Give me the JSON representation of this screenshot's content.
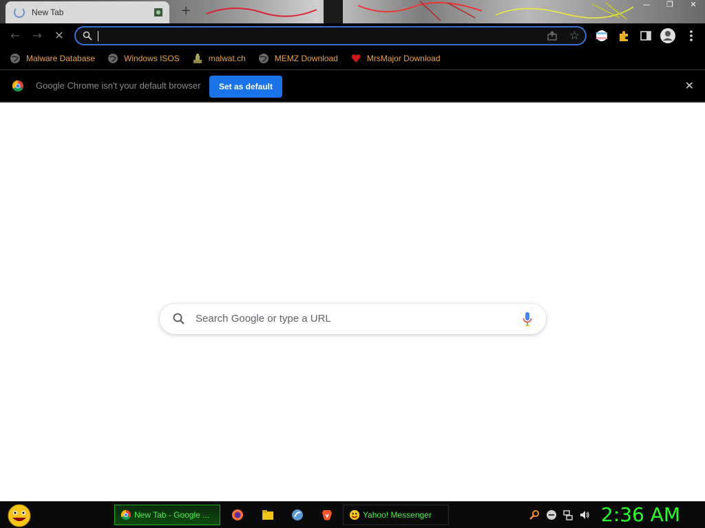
{
  "window": {
    "minimize_glyph": "—",
    "restore_glyph": "❐",
    "close_glyph": "✕"
  },
  "tab": {
    "title": "New Tab",
    "new_tab_glyph": "+"
  },
  "nav": {
    "back_glyph": "←",
    "forward_glyph": "→",
    "stop_glyph": "✕"
  },
  "omnibox": {
    "value": "",
    "star_glyph": "☆"
  },
  "bookmarks": [
    {
      "label": "Malware Database",
      "icon": "globe-icon"
    },
    {
      "label": "Windows ISOS",
      "icon": "globe-icon"
    },
    {
      "label": "malwat.ch",
      "icon": "malwatch-icon"
    },
    {
      "label": "MEMZ Download",
      "icon": "globe-icon"
    },
    {
      "label": "MrsMajor Download",
      "icon": "heart-icon"
    }
  ],
  "infobar": {
    "text": "Google Chrome isn't your default browser",
    "button": "Set as default",
    "close_glyph": "✕"
  },
  "ntp": {
    "search_placeholder": "Search Google or type a URL"
  },
  "taskbar": {
    "items": [
      {
        "label": "New Tab - Google ...",
        "icon": "chrome-icon",
        "active": true
      },
      {
        "label": "Yahoo! Messenger",
        "icon": "yahoo-messenger-icon",
        "active": false
      }
    ],
    "quick_launch": [
      "firefox-icon",
      "folder-icon",
      "tor-icon",
      "brave-icon"
    ],
    "clock": "2:36 AM"
  },
  "colors": {
    "accent_blue": "#1a73e8",
    "bookmark_text": "#e8a34a",
    "taskbar_green": "#4df04d",
    "clock_green": "#22ff22"
  }
}
